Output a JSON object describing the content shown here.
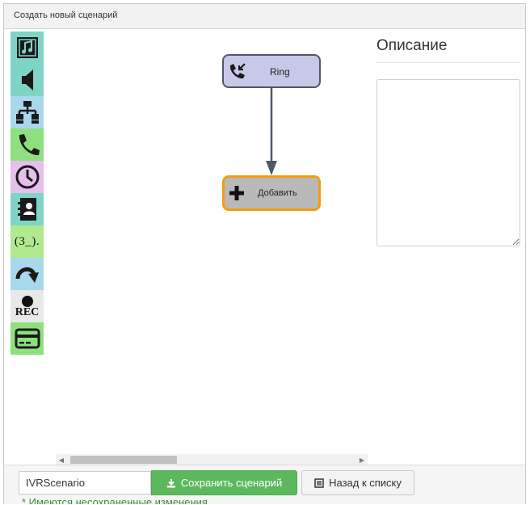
{
  "window": {
    "title": "Создать новый сценарий"
  },
  "palette": {
    "tools": [
      {
        "name": "tool-play-music",
        "icon": "music-note-icon",
        "bg": "#7fd4c6"
      },
      {
        "name": "tool-speaker",
        "icon": "speaker-icon",
        "bg": "#7fd4c6"
      },
      {
        "name": "tool-ivr-menu",
        "icon": "hierarchy-icon",
        "bg": "#a9d8ec"
      },
      {
        "name": "tool-call",
        "icon": "phone-icon",
        "bg": "#8ee07e"
      },
      {
        "name": "tool-schedule",
        "icon": "clock-icon",
        "bg": "#e4c0ea"
      },
      {
        "name": "tool-contacts",
        "icon": "address-book-icon",
        "bg": "#7fd4c6"
      },
      {
        "name": "tool-number-input",
        "icon": "number-input-icon",
        "bg": "#b0e98e",
        "text": "(3_)."
      },
      {
        "name": "tool-goto",
        "icon": "redirect-arrow-icon",
        "bg": "#a9d8ec"
      },
      {
        "name": "tool-record",
        "icon": "record-icon",
        "bg": "#e8e8e8",
        "text": "REC"
      },
      {
        "name": "tool-payment",
        "icon": "credit-card-icon",
        "bg": "#8ee07e"
      }
    ]
  },
  "flow": {
    "start_node": {
      "label": "Ring",
      "icon": "incoming-call-icon"
    },
    "add_node": {
      "label": "Добавить",
      "icon": "plus-icon"
    }
  },
  "description": {
    "title": "Описание",
    "value": ""
  },
  "footer": {
    "scenario_name": "IVRScenario",
    "save_label": "Сохранить сценарий",
    "back_label": "Назад к списку",
    "unsaved_notice": "* Имеются несохраненные изменения"
  },
  "colors": {
    "accent_save": "#5cb85c",
    "add_node_border": "#f39c12",
    "start_node_bg": "#c8c9e8",
    "connector": "#4d5867"
  }
}
